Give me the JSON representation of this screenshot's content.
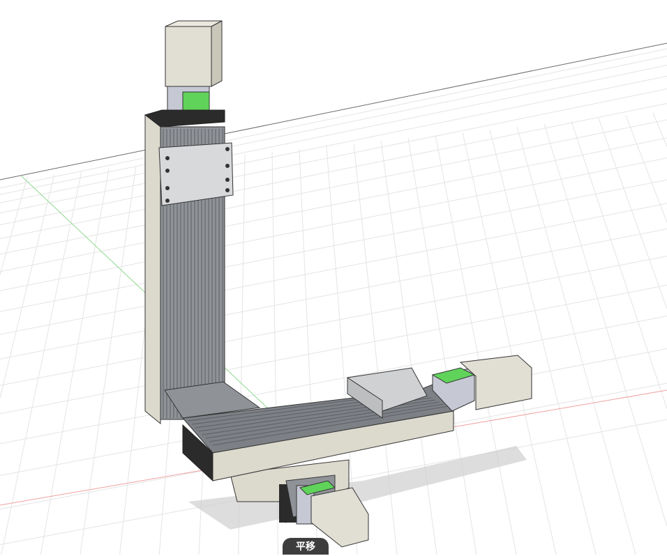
{
  "viewport": {
    "tooltip": "平移"
  },
  "colors": {
    "body": "#dcd9cd",
    "motor_mount": "#5fd35a",
    "end_cap": "#2b2b2b",
    "rail": "#8f9398",
    "plate": "#cfd0d2"
  }
}
